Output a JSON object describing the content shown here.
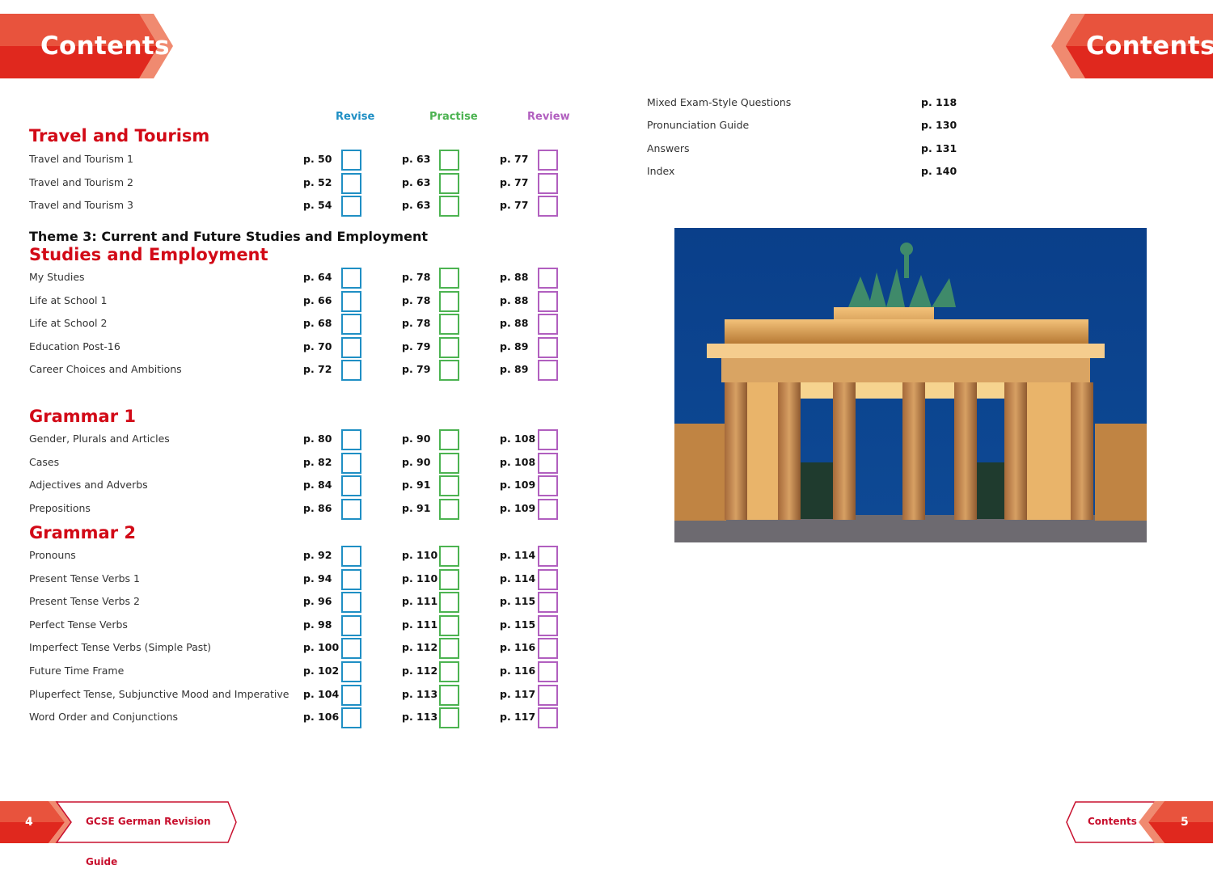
{
  "header": {
    "left_title": "Contents",
    "right_title": "Contents"
  },
  "columns": {
    "revise": {
      "label": "Revise",
      "color": "#1f8fc4"
    },
    "practise": {
      "label": "Practise",
      "color": "#4cb351"
    },
    "review": {
      "label": "Review",
      "color": "#b15fbf"
    }
  },
  "sections": {
    "travel": {
      "title": "Travel and Tourism",
      "rows": [
        {
          "topic": "Travel and Tourism 1",
          "revise": "p. 50",
          "practise": "p. 63",
          "review": "p. 77"
        },
        {
          "topic": "Travel and Tourism 2",
          "revise": "p. 52",
          "practise": "p. 63",
          "review": "p. 77"
        },
        {
          "topic": "Travel and Tourism 3",
          "revise": "p. 54",
          "practise": "p. 63",
          "review": "p. 77"
        }
      ]
    },
    "studies": {
      "theme": "Theme 3: Current and Future Studies and Employment",
      "title": "Studies and Employment",
      "rows": [
        {
          "topic": "My Studies",
          "revise": "p. 64",
          "practise": "p. 78",
          "review": "p. 88"
        },
        {
          "topic": "Life at School 1",
          "revise": "p. 66",
          "practise": "p. 78",
          "review": "p. 88"
        },
        {
          "topic": "Life at School 2",
          "revise": "p. 68",
          "practise": "p. 78",
          "review": "p. 88"
        },
        {
          "topic": "Education Post-16",
          "revise": "p. 70",
          "practise": "p. 79",
          "review": "p. 89"
        },
        {
          "topic": "Career Choices and Ambitions",
          "revise": "p. 72",
          "practise": "p. 79",
          "review": "p. 89"
        }
      ]
    },
    "grammar1": {
      "title": "Grammar 1",
      "rows": [
        {
          "topic": "Gender, Plurals and Articles",
          "revise": "p. 80",
          "practise": "p. 90",
          "review": "p. 108"
        },
        {
          "topic": "Cases",
          "revise": "p. 82",
          "practise": "p. 90",
          "review": "p. 108"
        },
        {
          "topic": "Adjectives and Adverbs",
          "revise": "p. 84",
          "practise": "p. 91",
          "review": "p. 109"
        },
        {
          "topic": "Prepositions",
          "revise": "p. 86",
          "practise": "p. 91",
          "review": "p. 109"
        }
      ]
    },
    "grammar2": {
      "title": "Grammar 2",
      "rows": [
        {
          "topic": "Pronouns",
          "revise": "p. 92",
          "practise": "p. 110",
          "review": "p. 114"
        },
        {
          "topic": "Present Tense Verbs 1",
          "revise": "p. 94",
          "practise": "p. 110",
          "review": "p. 114"
        },
        {
          "topic": "Present Tense Verbs 2",
          "revise": "p. 96",
          "practise": "p. 111",
          "review": "p. 115"
        },
        {
          "topic": "Perfect Tense Verbs",
          "revise": "p. 98",
          "practise": "p. 111",
          "review": "p. 115"
        },
        {
          "topic": "Imperfect Tense Verbs (Simple Past)",
          "revise": "p. 100",
          "practise": "p. 112",
          "review": "p. 116"
        },
        {
          "topic": "Future Time Frame",
          "revise": "p. 102",
          "practise": "p. 112",
          "review": "p. 116"
        },
        {
          "topic": "Pluperfect Tense, Subjunctive Mood and Imperative",
          "revise": "p. 104",
          "practise": "p. 113",
          "review": "p. 117"
        },
        {
          "topic": "Word Order and Conjunctions",
          "revise": "p. 106",
          "practise": "p. 113",
          "review": "p. 117"
        }
      ]
    }
  },
  "extras": [
    {
      "topic": "Mixed Exam-Style Questions",
      "page": "p. 118"
    },
    {
      "topic": "Pronunciation Guide",
      "page": "p. 130"
    },
    {
      "topic": "Answers",
      "page": "p. 131"
    },
    {
      "topic": "Index",
      "page": "p. 140"
    }
  ],
  "photo": {
    "subject": "Brandenburg Gate illuminated at dusk"
  },
  "footer": {
    "left_page": "4",
    "left_title": "GCSE German Revision Guide",
    "right_title": "Contents",
    "right_page": "5"
  },
  "colors": {
    "brand_red": "#d20a17",
    "banner_light": "#e8533d",
    "banner_tip": "#f08a70"
  }
}
